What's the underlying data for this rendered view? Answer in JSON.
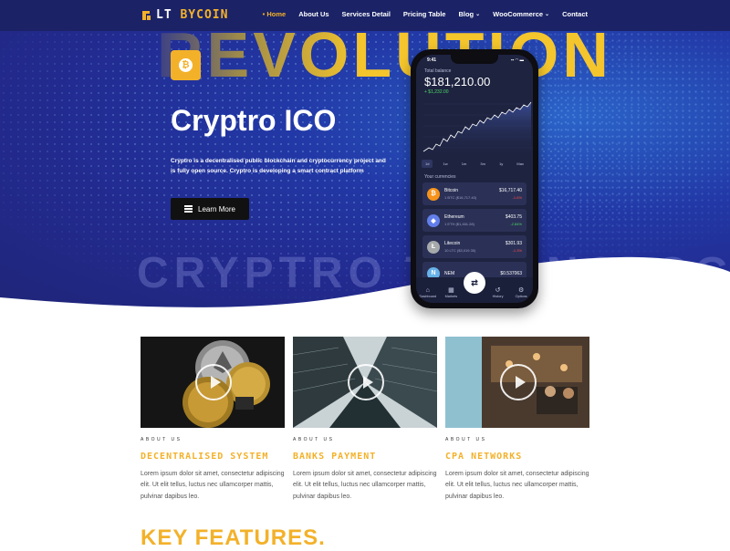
{
  "nav": {
    "logo": {
      "part1": "LT",
      "part2": "BYCOIN"
    },
    "items": [
      {
        "label": "• Home",
        "active": true,
        "dropdown": false
      },
      {
        "label": "About Us",
        "active": false,
        "dropdown": false
      },
      {
        "label": "Services Detail",
        "active": false,
        "dropdown": false
      },
      {
        "label": "Pricing Table",
        "active": false,
        "dropdown": false
      },
      {
        "label": "Blog",
        "active": false,
        "dropdown": true
      },
      {
        "label": "WooCommerce",
        "active": false,
        "dropdown": true
      },
      {
        "label": "Contact",
        "active": false,
        "dropdown": false
      }
    ]
  },
  "hero": {
    "bg_word_top": "REVOLUTION",
    "bg_word_bottom": "CRYPTRO TECHNOLOGY",
    "badge_glyph": "₿",
    "title": "Cryptro ICO",
    "description": "Cryptro is a decentralised public blockchain and cryptocurrency project and is fully open source. Cryptro is developing a smart contract platform",
    "button_label": "Learn More"
  },
  "phone": {
    "time": "9:41",
    "status": "▪▪ ◠ ▬",
    "total_label": "Total balance",
    "balance": "$181,210.00",
    "change": "+ $1,232.00",
    "ranges": [
      "1d",
      "1w",
      "1m",
      "3m",
      "1y",
      "Max"
    ],
    "selected_range": "1d",
    "currencies_label": "Your currencies",
    "coins": [
      {
        "name": "Bitcoin",
        "sub": "1 BTC ($16,717.40)",
        "price": "$16,717.40",
        "pct": "-1.6%",
        "dir": "down",
        "icon": "₿",
        "color": "#f7931a"
      },
      {
        "name": "Ethereum",
        "sub": "1 ETH ($1,461.28)",
        "price": "$403.75",
        "pct": "-2.84%",
        "dir": "up",
        "icon": "◆",
        "color": "#627eea"
      },
      {
        "name": "Litecoin",
        "sub": "10 LTC ($3,019.30)",
        "price": "$301.93",
        "pct": "-1.3%",
        "dir": "down",
        "icon": "Ł",
        "color": "#a6a9aa"
      },
      {
        "name": "NEM",
        "sub": "",
        "price": "$0.537063",
        "pct": "",
        "dir": "down",
        "icon": "N",
        "color": "#67b2e8"
      }
    ],
    "tabs": [
      {
        "label": "Dashboard",
        "icon": "⌂"
      },
      {
        "label": "Markets",
        "icon": "▦"
      },
      {
        "label": "",
        "icon": ""
      },
      {
        "label": "History",
        "icon": "↺"
      },
      {
        "label": "Options",
        "icon": "⚙"
      }
    ],
    "center_button": "⇄"
  },
  "cards": [
    {
      "kicker": "ABOUT US",
      "title": "DECENTRALISED SYSTEM",
      "text": "Lorem ipsum dolor sit amet, consectetur adipiscing elit. Ut elit tellus, luctus nec ullamcorper mattis, pulvinar dapibus leo."
    },
    {
      "kicker": "ABOUT US",
      "title": "BANKS PAYMENT",
      "text": "Lorem ipsum dolor sit amet, consectetur adipiscing elit. Ut elit tellus, luctus nec ullamcorper mattis, pulvinar dapibus leo."
    },
    {
      "kicker": "ABOUT US",
      "title": "CPA NETWORKS",
      "text": "Lorem ipsum dolor sit amet, consectetur adipiscing elit. Ut elit tellus, luctus nec ullamcorper mattis, pulvinar dapibus leo."
    }
  ],
  "key_features": "KEY FEATURES.",
  "colors": {
    "accent": "#f3b12a",
    "nav_bg": "#1b2366",
    "hero_bg": "#222a8f"
  }
}
